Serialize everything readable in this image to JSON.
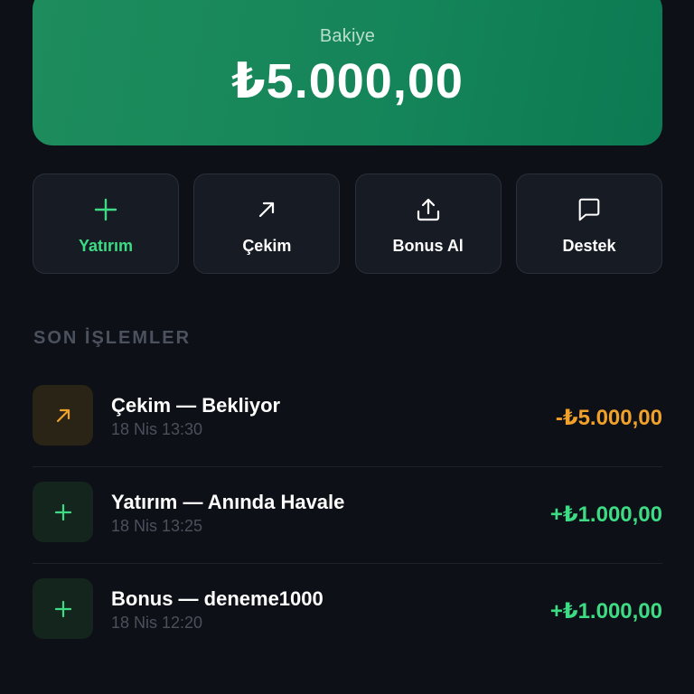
{
  "balance": {
    "label": "Bakiye",
    "amount": "₺5.000,00"
  },
  "actions": [
    {
      "label": "Yatırım",
      "icon": "plus-icon"
    },
    {
      "label": "Çekim",
      "icon": "arrow-up-right-icon"
    },
    {
      "label": "Bonus Al",
      "icon": "share-upload-icon"
    },
    {
      "label": "Destek",
      "icon": "chat-bubble-icon"
    }
  ],
  "section": {
    "title": "SON İŞLEMLER"
  },
  "transactions": [
    {
      "title": "Çekim — Bekliyor",
      "time": "18 Nis 13:30",
      "amount": "-₺5.000,00",
      "icon": "arrow-up-right-icon",
      "status_color": "#f0a12a"
    },
    {
      "title": "Yatırım — Anında Havale",
      "time": "18 Nis 13:25",
      "amount": "+₺1.000,00",
      "icon": "plus-icon",
      "status_color": "#3ddc84"
    },
    {
      "title": "Bonus — deneme1000",
      "time": "18 Nis 12:20",
      "amount": "+₺1.000,00",
      "icon": "plus-icon",
      "status_color": "#3ddc84"
    }
  ],
  "colors": {
    "accent_green": "#3ddc84",
    "warning_orange": "#f0a12a",
    "card_green": "#15855a",
    "background": "#0d1016"
  }
}
